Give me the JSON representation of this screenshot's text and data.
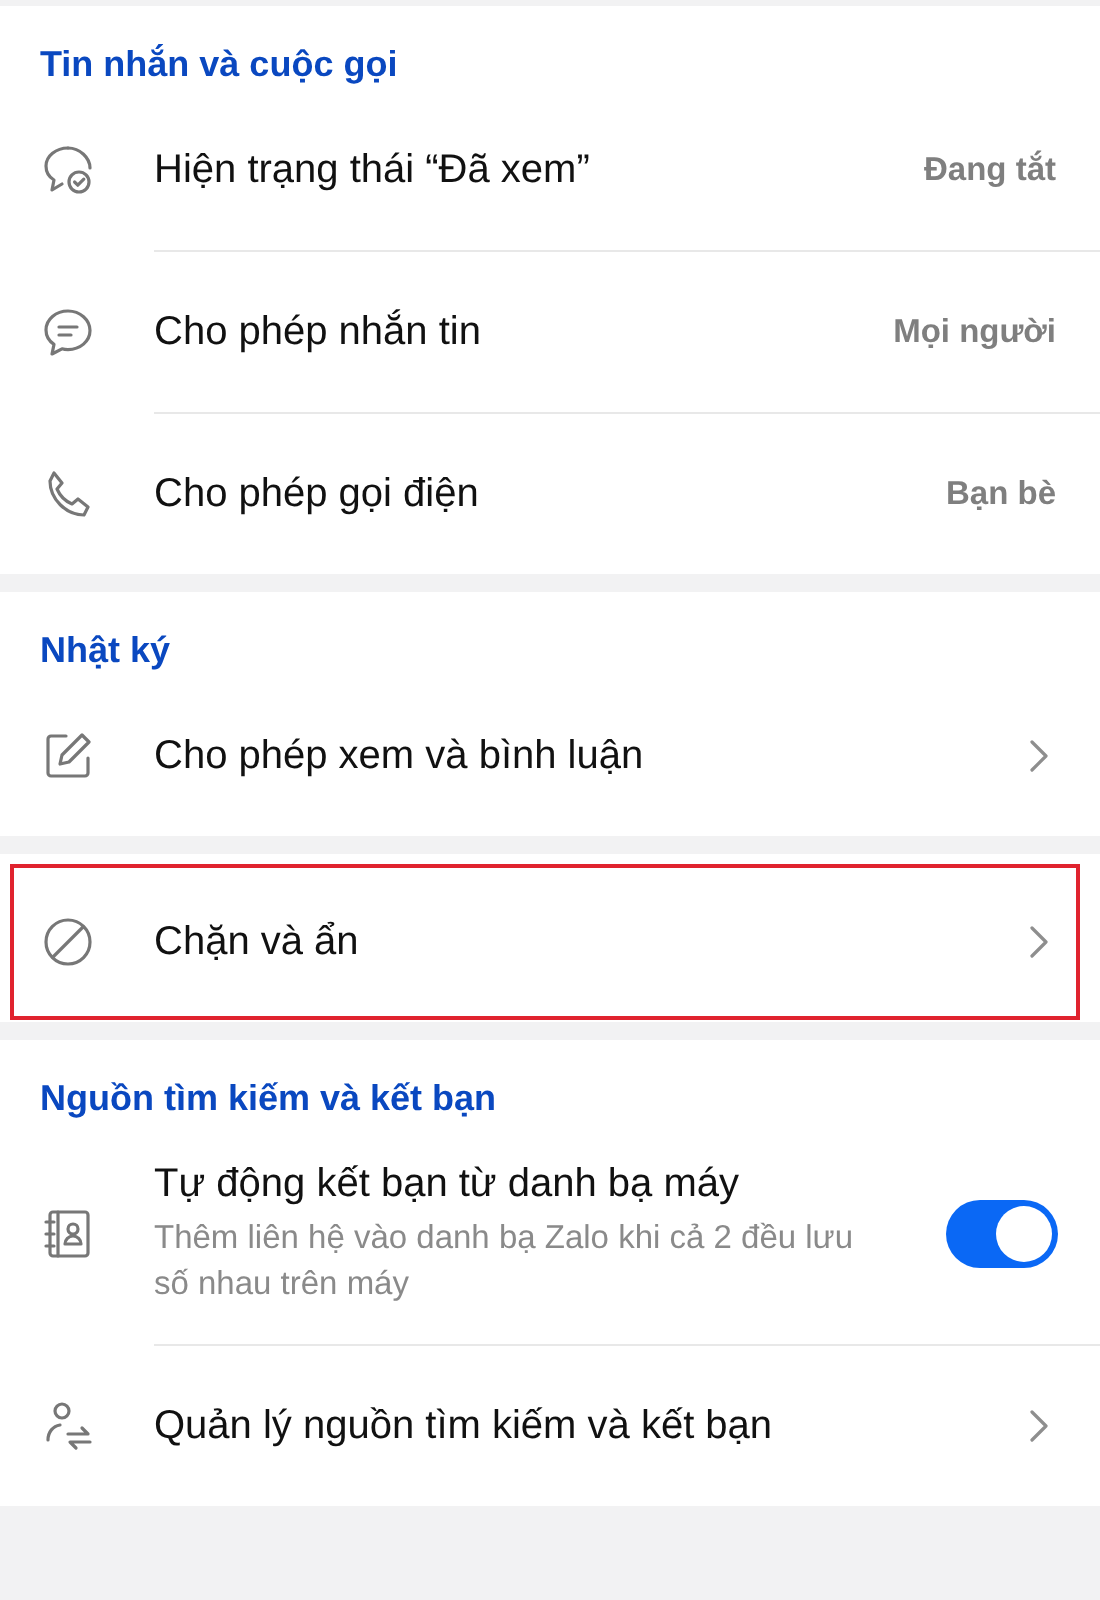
{
  "sections": [
    {
      "title": "Tin nhắn và cuộc gọi",
      "rows": [
        {
          "kind": "value",
          "label": "Hiện trạng thái “Đã xem”",
          "value": "Đang tắt",
          "highlighted": false
        },
        {
          "kind": "value",
          "label": "Cho phép nhắn tin",
          "value": "Mọi người",
          "highlighted": false
        },
        {
          "kind": "value",
          "label": "Cho phép gọi điện",
          "value": "Bạn bè",
          "highlighted": false
        }
      ]
    },
    {
      "title": "Nhật ký",
      "rows": [
        {
          "kind": "link",
          "label": "Cho phép xem và bình luận",
          "highlighted": false
        }
      ]
    },
    {
      "rows": [
        {
          "kind": "link",
          "label": "Chặn và ẩn",
          "highlighted": true
        }
      ]
    },
    {
      "title": "Nguồn tìm kiếm và kết bạn",
      "rows": [
        {
          "kind": "toggle",
          "label": "Tự động kết bạn từ danh bạ máy",
          "description": "Thêm liên hệ vào danh bạ Zalo khi cả 2 đều lưu số nhau trên máy",
          "on": true,
          "highlighted": false
        },
        {
          "kind": "link",
          "label": "Quản lý nguồn tìm kiếm và kết bạn",
          "highlighted": false
        }
      ]
    }
  ]
}
